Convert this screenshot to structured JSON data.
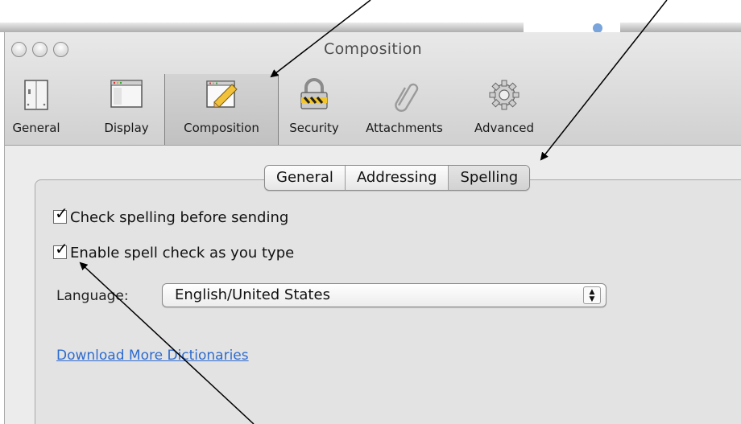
{
  "window": {
    "title": "Composition"
  },
  "toolbar": {
    "items": [
      {
        "label": "General",
        "icon": "general-prefs-icon"
      },
      {
        "label": "Display",
        "icon": "display-prefs-icon"
      },
      {
        "label": "Composition",
        "icon": "composition-pencil-icon",
        "selected": true
      },
      {
        "label": "Security",
        "icon": "security-padlock-icon"
      },
      {
        "label": "Attachments",
        "icon": "paperclip-icon"
      },
      {
        "label": "Advanced",
        "icon": "gear-icon"
      }
    ]
  },
  "tabs": [
    {
      "label": "General"
    },
    {
      "label": "Addressing"
    },
    {
      "label": "Spelling",
      "selected": true
    }
  ],
  "options": {
    "check_before_sending": {
      "label": "Check spelling before sending",
      "checked": true
    },
    "spell_check_as_type": {
      "label": "Enable spell check as you type",
      "checked": true
    }
  },
  "language": {
    "label": "Language:",
    "value": "English/United States"
  },
  "download_link": "Download More Dictionaries",
  "colors": {
    "link": "#2e6bd0",
    "window_bg": "#ececec"
  }
}
